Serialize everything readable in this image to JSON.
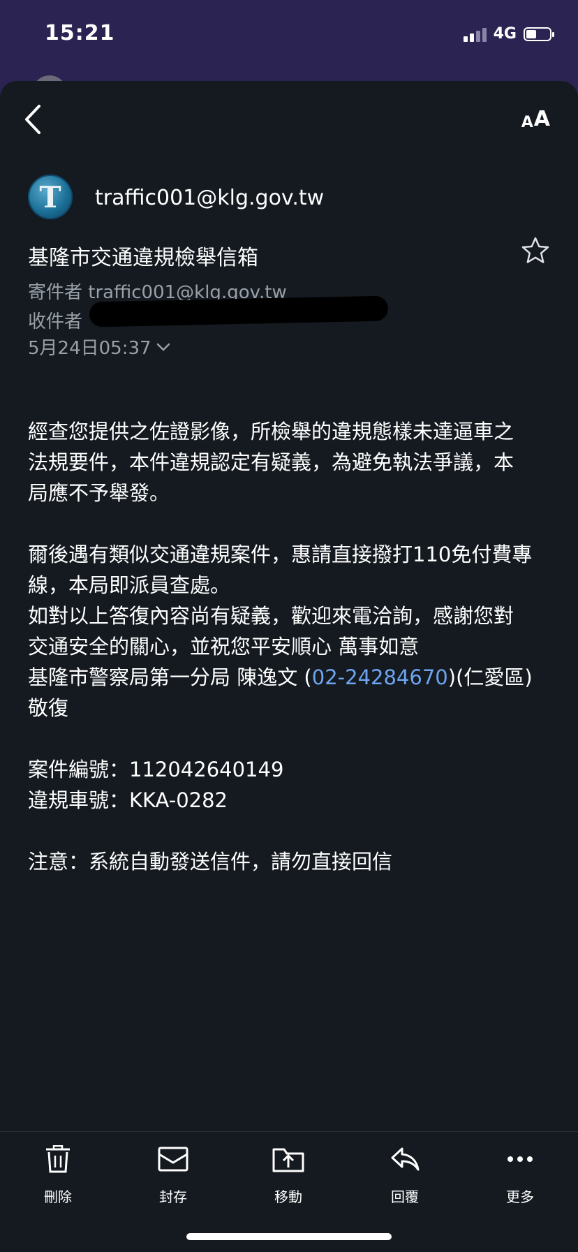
{
  "status_bar": {
    "time": "15:21",
    "network": "4G"
  },
  "header": {
    "back_icon": "chevron-left-icon",
    "text_size_label": "AA"
  },
  "email": {
    "sender_display": "traffic001@klg.gov.tw",
    "sender_avatar_letter": "T",
    "subject": "基隆市交通違規檢舉信箱",
    "from_label": "寄件者",
    "from_address": "traffic001@klg.gov.tw",
    "to_label": "收件者",
    "date": "5月24日05:37",
    "body": {
      "p1_l1": "經查您提供之佐證影像，所檢舉的違規態樣未達逼車之",
      "p1_l2": "法規要件，本件違規認定有疑義，為避免執法爭議，本",
      "p1_l3": "局應不予舉發。",
      "p2_l1": "爾後遇有類似交通違規案件，惠請直接撥打110免付費專",
      "p2_l2": "線，本局即派員查處。",
      "p2_l3": "如對以上答復內容尚有疑義，歡迎來電洽詢，感謝您對",
      "p2_l4": "交通安全的關心，並祝您平安順心 萬事如意",
      "sign_prefix": "基隆市警察局第一分局 陳逸文 (",
      "phone": "02-24284670",
      "sign_suffix": ")(仁愛區)",
      "sign_end": "敬復",
      "case_no": "案件編號：112042640149",
      "plate": "違規車號：KKA-0282",
      "notice": "注意：系統自動發送信件，請勿直接回信"
    }
  },
  "toolbar": {
    "delete": "刪除",
    "archive": "封存",
    "move": "移動",
    "reply": "回覆",
    "more": "更多"
  },
  "colors": {
    "status_bg": "#2b2352",
    "sheet_bg": "#141a20",
    "link": "#6ea4f0"
  }
}
